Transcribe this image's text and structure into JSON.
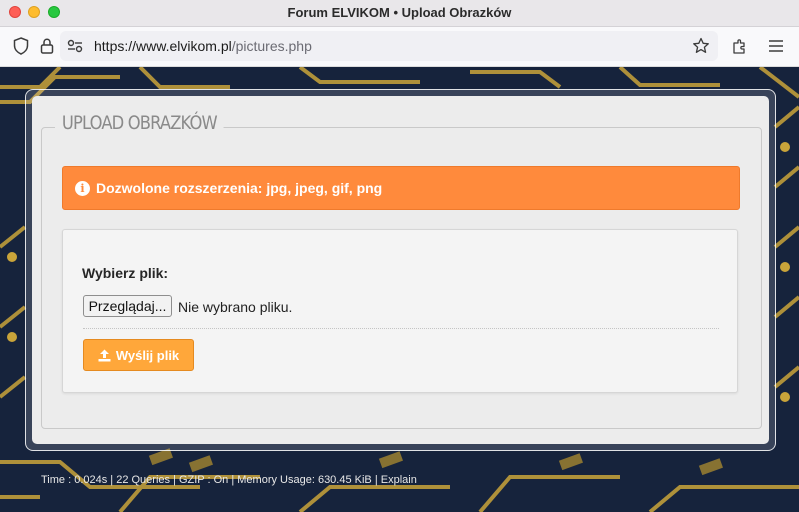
{
  "window": {
    "title": "Forum ELVIKOM • Upload Obrazków"
  },
  "navbar": {
    "url_main": "https://www.elvikom.pl",
    "url_path": "/pictures.php"
  },
  "content": {
    "legend": "UPLOAD OBRAZKÓW",
    "alert_text": "Dozwolone rozszerzenia: jpg, jpeg, gif, png",
    "alert_icon": "info-icon",
    "file_label": "Wybierz plik:",
    "browse_button": "Przeglądaj...",
    "file_status": "Nie wybrano pliku.",
    "submit_label": "Wyślij plik",
    "submit_icon": "upload-icon"
  },
  "footer": {
    "text": "Time : 0.024s | 22 Queries | GZIP : On | Memory Usage: 630.45 KiB | Explain"
  },
  "colors": {
    "alert_bg": "#ff8a3c",
    "submit_bg": "#ffa73a",
    "page_bg": "#15213a"
  }
}
